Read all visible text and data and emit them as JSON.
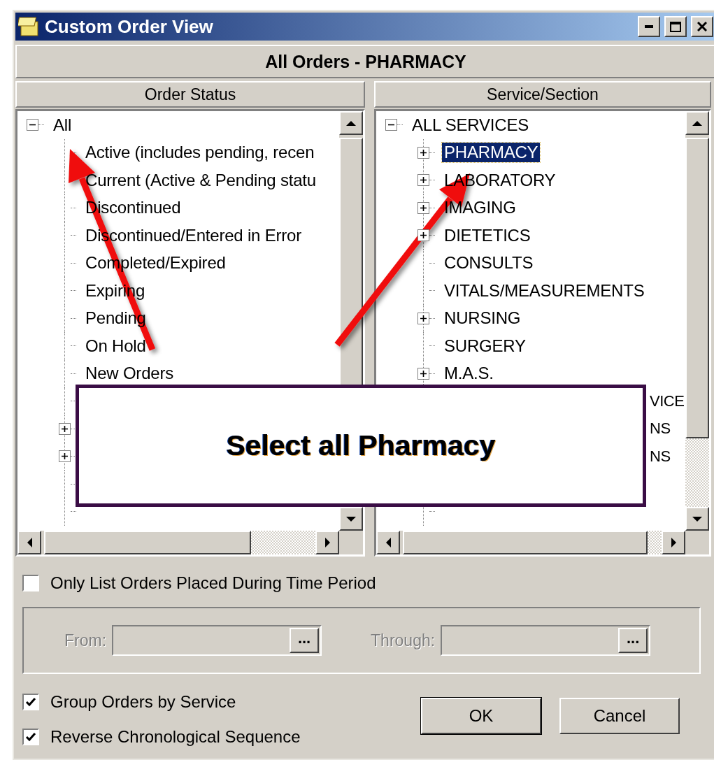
{
  "window": {
    "title": "Custom Order View"
  },
  "header": "All Orders - PHARMACY",
  "order_status": {
    "heading": "Order Status",
    "tree": [
      {
        "kind": "node",
        "label": "All",
        "expanded": true,
        "selected": false,
        "children": [
          {
            "kind": "node",
            "label": "Active (includes pending, recen",
            "selected": false
          },
          {
            "kind": "node",
            "label": "Current (Active & Pending statu",
            "selected": false
          },
          {
            "kind": "node",
            "label": "Discontinued",
            "selected": false
          },
          {
            "kind": "node",
            "label": "Discontinued/Entered in Error",
            "selected": false
          },
          {
            "kind": "node",
            "label": "Completed/Expired",
            "selected": false
          },
          {
            "kind": "node",
            "label": "Expiring",
            "selected": false
          },
          {
            "kind": "node",
            "label": "Pending",
            "selected": false
          },
          {
            "kind": "node",
            "label": "On Hold",
            "selected": false
          },
          {
            "kind": "node",
            "label": "New Orders",
            "selected": false
          },
          {
            "kind": "node"
          },
          {
            "kind": "node",
            "expanded": false
          },
          {
            "kind": "node",
            "expanded": false
          },
          {
            "kind": "node"
          },
          {
            "kind": "node"
          }
        ]
      }
    ]
  },
  "service_section": {
    "heading": "Service/Section",
    "tree": [
      {
        "kind": "node",
        "label": "ALL SERVICES",
        "expanded": true,
        "selected": false,
        "children": [
          {
            "kind": "node",
            "label": "PHARMACY",
            "expanded": false,
            "selected": true
          },
          {
            "kind": "node",
            "label": "LABORATORY",
            "expanded": false,
            "selected": false
          },
          {
            "kind": "node",
            "label": "IMAGING",
            "expanded": false,
            "selected": false
          },
          {
            "kind": "node",
            "label": "DIETETICS",
            "expanded": false,
            "selected": false
          },
          {
            "kind": "node",
            "label": "CONSULTS",
            "selected": false
          },
          {
            "kind": "node",
            "label": "VITALS/MEASUREMENTS",
            "selected": false
          },
          {
            "kind": "node",
            "label": "NURSING",
            "expanded": false,
            "selected": false
          },
          {
            "kind": "node",
            "label": "SURGERY",
            "selected": false
          },
          {
            "kind": "node",
            "label": "M.A.S.",
            "expanded": false,
            "selected": false
          },
          {
            "kind": "fragment",
            "label": "VICE",
            "selected": false
          },
          {
            "kind": "fragment",
            "label": "NS",
            "selected": false
          },
          {
            "kind": "fragment",
            "label": "NS",
            "selected": false
          },
          {
            "kind": "node"
          },
          {
            "kind": "node"
          }
        ]
      }
    ]
  },
  "time_period": {
    "label": "Only List Orders Placed During Time Period",
    "checked": false
  },
  "range": {
    "disabled": true,
    "fields": [
      {
        "label": "From:",
        "button": "..."
      },
      {
        "label": "Through:",
        "button": "..."
      }
    ]
  },
  "options": [
    {
      "label": "Group Orders by Service",
      "checked": true
    },
    {
      "label": "Reverse Chronological Sequence",
      "checked": true
    }
  ],
  "buttons": [
    "OK",
    "Cancel"
  ],
  "callout": {
    "text": "Select all Pharmacy"
  }
}
